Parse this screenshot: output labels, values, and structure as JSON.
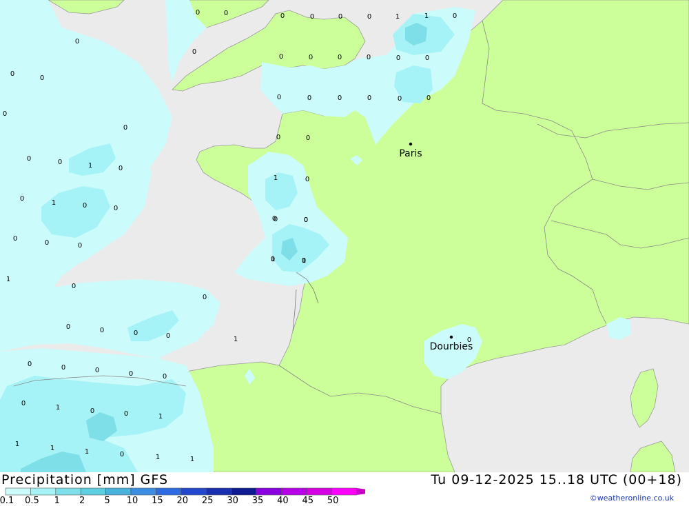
{
  "map": {
    "title": "Precipitation [mm] GFS",
    "valid_time": "Tu 09-12-2025 15..18 UTC (00+18)",
    "credit": "©weatheronline.co.uk",
    "cities": [
      {
        "name": "Paris"
      },
      {
        "name": "Dourbies"
      }
    ],
    "colors": {
      "sea": "#ebebeb",
      "land": "#ccff99",
      "precip_light": "#ccfbfb",
      "precip_medium": "#a6f3f7",
      "precip_heavy": "#7fdfe8",
      "border": "#888888"
    },
    "grid_values": [
      "0",
      "0",
      "0",
      "0",
      "0",
      "0",
      "1",
      "1",
      "0",
      "0",
      "0",
      "0",
      "0",
      "0",
      "0",
      "0",
      "0",
      "0",
      "0",
      "0",
      "0",
      "0",
      "0",
      "0",
      "0",
      "0",
      "0",
      "0",
      "0",
      "0",
      "0",
      "1",
      "0",
      "1",
      "0",
      "0",
      "1",
      "0",
      "0",
      "0",
      "0",
      "0",
      "0",
      "0",
      "0",
      "1",
      "1",
      "0",
      "0",
      "0",
      "0",
      "0",
      "0",
      "1",
      "0",
      "0",
      "0",
      "0",
      "0",
      "0",
      "0",
      "1",
      "0",
      "0",
      "1",
      "1",
      "1",
      "1",
      "0",
      "1",
      "1",
      "0",
      "0",
      "1",
      "0"
    ]
  },
  "legend": {
    "labels": [
      "0.1",
      "0.5",
      "1",
      "2",
      "5",
      "10",
      "15",
      "20",
      "25",
      "30",
      "35",
      "40",
      "45",
      "50"
    ],
    "colors": [
      "#ccfbfb",
      "#a6f3f7",
      "#7fdfe8",
      "#5fcde0",
      "#4ab0dc",
      "#3c8ee0",
      "#2f6be0",
      "#2448cc",
      "#1a2fb0",
      "#0d1a90",
      "#8a00e0",
      "#b300e6",
      "#d600e0",
      "#ff00ff",
      "#c800c8"
    ]
  }
}
